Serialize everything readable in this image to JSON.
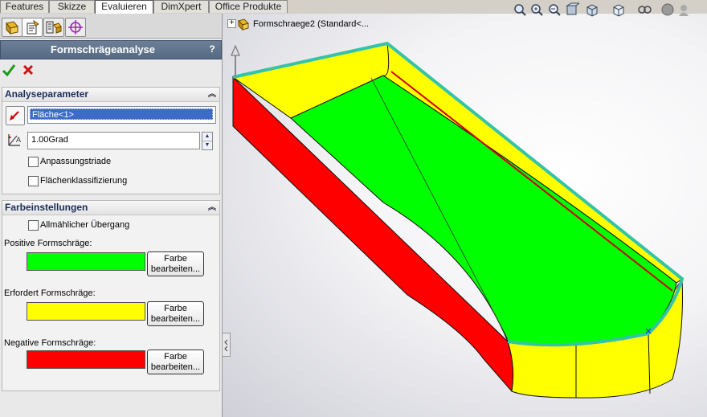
{
  "tabs": [
    "Features",
    "Skizze",
    "Evaluieren",
    "DimXpert",
    "Office Produkte"
  ],
  "active_tab": "Evaluieren",
  "property_manager": {
    "title": "Formschrägeanalyse",
    "help": "?"
  },
  "analysis_params": {
    "header": "Analyseparameter",
    "face_value": "Fläche<1>",
    "angle_value": "1.00Grad",
    "checkbox_triad": "Anpassungstriade",
    "checkbox_classify": "Flächenklassifizierung"
  },
  "color_settings": {
    "header": "Farbeinstellungen",
    "checkbox_gradual": "Allmählicher Übergang",
    "positive_label": "Positive Formschräge:",
    "required_label": "Erfordert Formschräge:",
    "negative_label": "Negative Formschräge:",
    "edit_button_line1": "Farbe",
    "edit_button_line2": "bearbeiten...",
    "colors": {
      "positive": "#00ff00",
      "required": "#ffff00",
      "negative": "#ff0000"
    }
  },
  "feature_tree": {
    "expand": "+",
    "item_label": "Formschraege2  (Standard<..."
  },
  "icons": [
    "ok-check-icon",
    "cancel-x-icon",
    "feature-manager-icon",
    "property-manager-icon",
    "configuration-manager-icon",
    "dimxpert-manager-icon",
    "zoom-to-fit-icon",
    "zoom-to-area-icon",
    "previous-view-icon",
    "section-view-icon",
    "view-orientation-icon",
    "display-style-icon",
    "hide-show-icon",
    "edit-appearance-icon",
    "apply-scene-icon",
    "view-settings-icon"
  ]
}
